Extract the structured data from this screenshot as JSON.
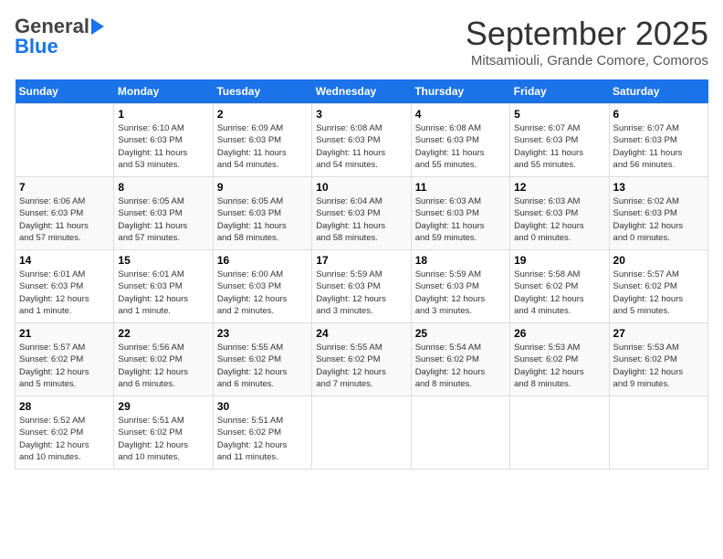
{
  "header": {
    "logo_general": "General",
    "logo_blue": "Blue",
    "month": "September 2025",
    "location": "Mitsamiouli, Grande Comore, Comoros"
  },
  "days_of_week": [
    "Sunday",
    "Monday",
    "Tuesday",
    "Wednesday",
    "Thursday",
    "Friday",
    "Saturday"
  ],
  "weeks": [
    [
      {
        "day": "",
        "info": ""
      },
      {
        "day": "1",
        "info": "Sunrise: 6:10 AM\nSunset: 6:03 PM\nDaylight: 11 hours\nand 53 minutes."
      },
      {
        "day": "2",
        "info": "Sunrise: 6:09 AM\nSunset: 6:03 PM\nDaylight: 11 hours\nand 54 minutes."
      },
      {
        "day": "3",
        "info": "Sunrise: 6:08 AM\nSunset: 6:03 PM\nDaylight: 11 hours\nand 54 minutes."
      },
      {
        "day": "4",
        "info": "Sunrise: 6:08 AM\nSunset: 6:03 PM\nDaylight: 11 hours\nand 55 minutes."
      },
      {
        "day": "5",
        "info": "Sunrise: 6:07 AM\nSunset: 6:03 PM\nDaylight: 11 hours\nand 55 minutes."
      },
      {
        "day": "6",
        "info": "Sunrise: 6:07 AM\nSunset: 6:03 PM\nDaylight: 11 hours\nand 56 minutes."
      }
    ],
    [
      {
        "day": "7",
        "info": "Sunrise: 6:06 AM\nSunset: 6:03 PM\nDaylight: 11 hours\nand 57 minutes."
      },
      {
        "day": "8",
        "info": "Sunrise: 6:05 AM\nSunset: 6:03 PM\nDaylight: 11 hours\nand 57 minutes."
      },
      {
        "day": "9",
        "info": "Sunrise: 6:05 AM\nSunset: 6:03 PM\nDaylight: 11 hours\nand 58 minutes."
      },
      {
        "day": "10",
        "info": "Sunrise: 6:04 AM\nSunset: 6:03 PM\nDaylight: 11 hours\nand 58 minutes."
      },
      {
        "day": "11",
        "info": "Sunrise: 6:03 AM\nSunset: 6:03 PM\nDaylight: 11 hours\nand 59 minutes."
      },
      {
        "day": "12",
        "info": "Sunrise: 6:03 AM\nSunset: 6:03 PM\nDaylight: 12 hours\nand 0 minutes."
      },
      {
        "day": "13",
        "info": "Sunrise: 6:02 AM\nSunset: 6:03 PM\nDaylight: 12 hours\nand 0 minutes."
      }
    ],
    [
      {
        "day": "14",
        "info": "Sunrise: 6:01 AM\nSunset: 6:03 PM\nDaylight: 12 hours\nand 1 minute."
      },
      {
        "day": "15",
        "info": "Sunrise: 6:01 AM\nSunset: 6:03 PM\nDaylight: 12 hours\nand 1 minute."
      },
      {
        "day": "16",
        "info": "Sunrise: 6:00 AM\nSunset: 6:03 PM\nDaylight: 12 hours\nand 2 minutes."
      },
      {
        "day": "17",
        "info": "Sunrise: 5:59 AM\nSunset: 6:03 PM\nDaylight: 12 hours\nand 3 minutes."
      },
      {
        "day": "18",
        "info": "Sunrise: 5:59 AM\nSunset: 6:03 PM\nDaylight: 12 hours\nand 3 minutes."
      },
      {
        "day": "19",
        "info": "Sunrise: 5:58 AM\nSunset: 6:02 PM\nDaylight: 12 hours\nand 4 minutes."
      },
      {
        "day": "20",
        "info": "Sunrise: 5:57 AM\nSunset: 6:02 PM\nDaylight: 12 hours\nand 5 minutes."
      }
    ],
    [
      {
        "day": "21",
        "info": "Sunrise: 5:57 AM\nSunset: 6:02 PM\nDaylight: 12 hours\nand 5 minutes."
      },
      {
        "day": "22",
        "info": "Sunrise: 5:56 AM\nSunset: 6:02 PM\nDaylight: 12 hours\nand 6 minutes."
      },
      {
        "day": "23",
        "info": "Sunrise: 5:55 AM\nSunset: 6:02 PM\nDaylight: 12 hours\nand 6 minutes."
      },
      {
        "day": "24",
        "info": "Sunrise: 5:55 AM\nSunset: 6:02 PM\nDaylight: 12 hours\nand 7 minutes."
      },
      {
        "day": "25",
        "info": "Sunrise: 5:54 AM\nSunset: 6:02 PM\nDaylight: 12 hours\nand 8 minutes."
      },
      {
        "day": "26",
        "info": "Sunrise: 5:53 AM\nSunset: 6:02 PM\nDaylight: 12 hours\nand 8 minutes."
      },
      {
        "day": "27",
        "info": "Sunrise: 5:53 AM\nSunset: 6:02 PM\nDaylight: 12 hours\nand 9 minutes."
      }
    ],
    [
      {
        "day": "28",
        "info": "Sunrise: 5:52 AM\nSunset: 6:02 PM\nDaylight: 12 hours\nand 10 minutes."
      },
      {
        "day": "29",
        "info": "Sunrise: 5:51 AM\nSunset: 6:02 PM\nDaylight: 12 hours\nand 10 minutes."
      },
      {
        "day": "30",
        "info": "Sunrise: 5:51 AM\nSunset: 6:02 PM\nDaylight: 12 hours\nand 11 minutes."
      },
      {
        "day": "",
        "info": ""
      },
      {
        "day": "",
        "info": ""
      },
      {
        "day": "",
        "info": ""
      },
      {
        "day": "",
        "info": ""
      }
    ]
  ]
}
